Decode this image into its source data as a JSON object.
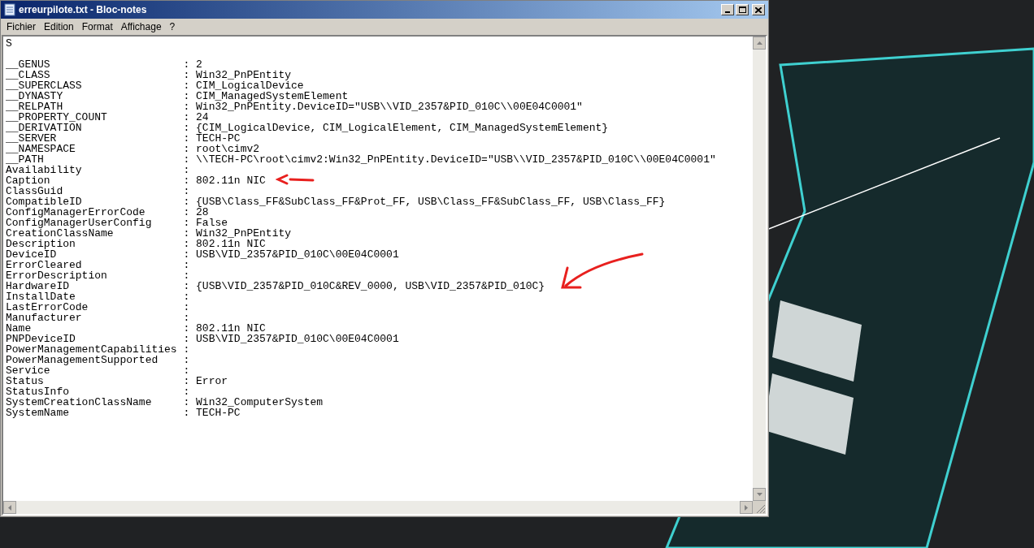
{
  "window": {
    "title": "erreurpilote.txt - Bloc-notes"
  },
  "menu": [
    {
      "label": "Fichier"
    },
    {
      "label": "Edition"
    },
    {
      "label": "Format"
    },
    {
      "label": "Affichage"
    },
    {
      "label": "?"
    }
  ],
  "document": {
    "first_line": "S",
    "lines": [
      "__GENUS                     : 2",
      "__CLASS                     : Win32_PnPEntity",
      "__SUPERCLASS                : CIM_LogicalDevice",
      "__DYNASTY                   : CIM_ManagedSystemElement",
      "__RELPATH                   : Win32_PnPEntity.DeviceID=\"USB\\\\VID_2357&PID_010C\\\\00E04C0001\"",
      "__PROPERTY_COUNT            : 24",
      "__DERIVATION                : {CIM_LogicalDevice, CIM_LogicalElement, CIM_ManagedSystemElement}",
      "__SERVER                    : TECH-PC",
      "__NAMESPACE                 : root\\cimv2",
      "__PATH                      : \\\\TECH-PC\\root\\cimv2:Win32_PnPEntity.DeviceID=\"USB\\\\VID_2357&PID_010C\\\\00E04C0001\"",
      "Availability                :",
      "Caption                     : 802.11n NIC",
      "ClassGuid                   :",
      "CompatibleID                : {USB\\Class_FF&SubClass_FF&Prot_FF, USB\\Class_FF&SubClass_FF, USB\\Class_FF}",
      "ConfigManagerErrorCode      : 28",
      "ConfigManagerUserConfig     : False",
      "CreationClassName           : Win32_PnPEntity",
      "Description                 : 802.11n NIC",
      "DeviceID                    : USB\\VID_2357&PID_010C\\00E04C0001",
      "ErrorCleared                :",
      "ErrorDescription            :",
      "HardwareID                  : {USB\\VID_2357&PID_010C&REV_0000, USB\\VID_2357&PID_010C}",
      "InstallDate                 :",
      "LastErrorCode               :",
      "Manufacturer                :",
      "Name                        : 802.11n NIC",
      "PNPDeviceID                 : USB\\VID_2357&PID_010C\\00E04C0001",
      "PowerManagementCapabilities :",
      "PowerManagementSupported    :",
      "Service                     :",
      "Status                      : Error",
      "StatusInfo                  :",
      "SystemCreationClassName     : Win32_ComputerSystem",
      "SystemName                  : TECH-PC"
    ]
  }
}
